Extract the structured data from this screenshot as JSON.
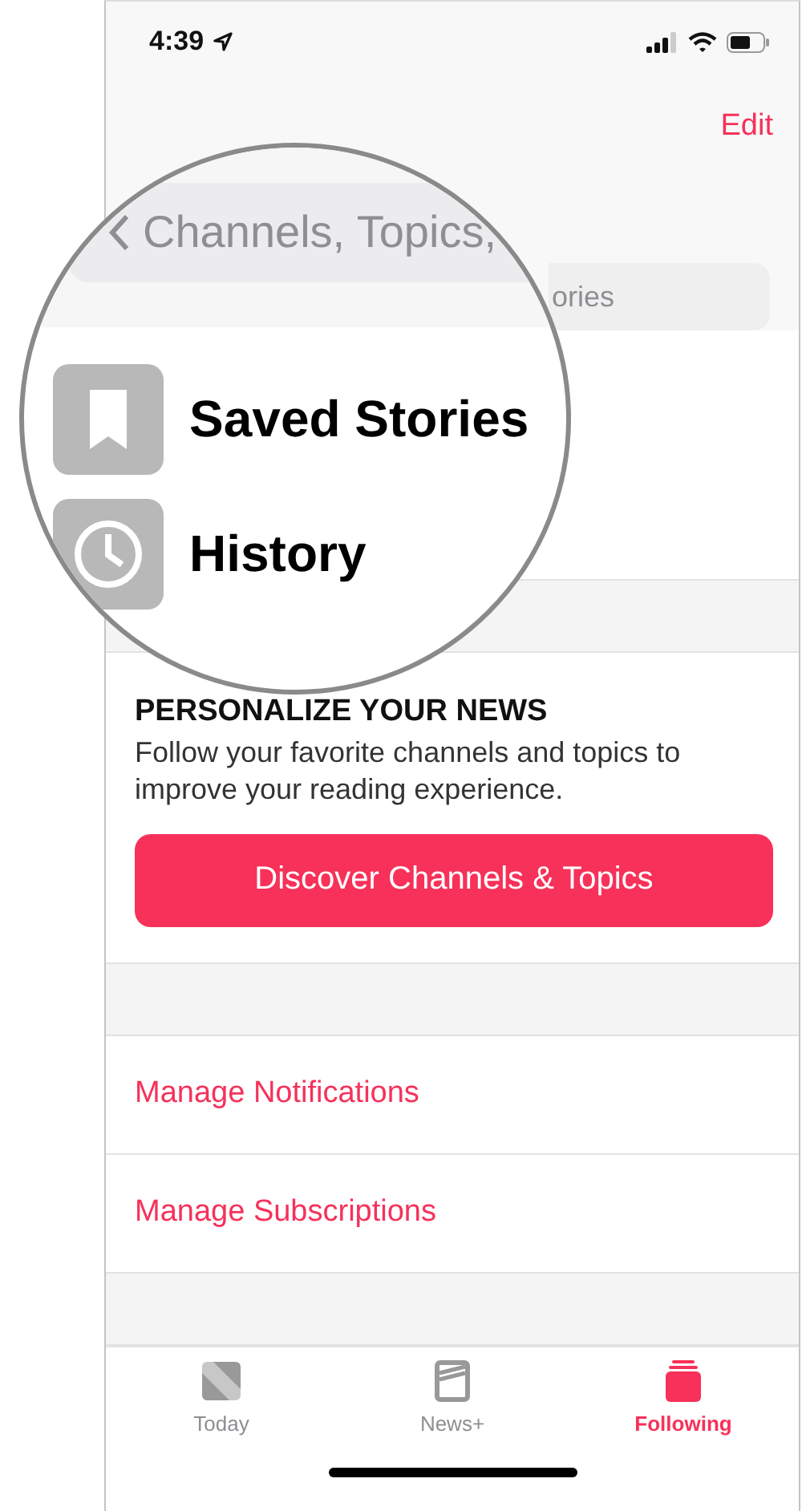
{
  "status_bar": {
    "time": "4:39"
  },
  "nav": {
    "edit": "Edit"
  },
  "search": {
    "placeholder": "ories"
  },
  "magnifier": {
    "search_text": "Channels, Topics,",
    "items": [
      {
        "kind": "saved",
        "label": "Saved Stories"
      },
      {
        "kind": "history",
        "label": "History"
      }
    ]
  },
  "personalize": {
    "title": "PERSONALIZE YOUR NEWS",
    "description": "Follow your favorite channels and topics to improve your reading experience.",
    "button": "Discover Channels & Topics"
  },
  "links": [
    "Manage Notifications",
    "Manage Subscriptions"
  ],
  "tabs": [
    {
      "label": "Today",
      "kind": "today",
      "selected": false
    },
    {
      "label": "News+",
      "kind": "newsplus",
      "selected": false
    },
    {
      "label": "Following",
      "kind": "following",
      "selected": true
    }
  ]
}
